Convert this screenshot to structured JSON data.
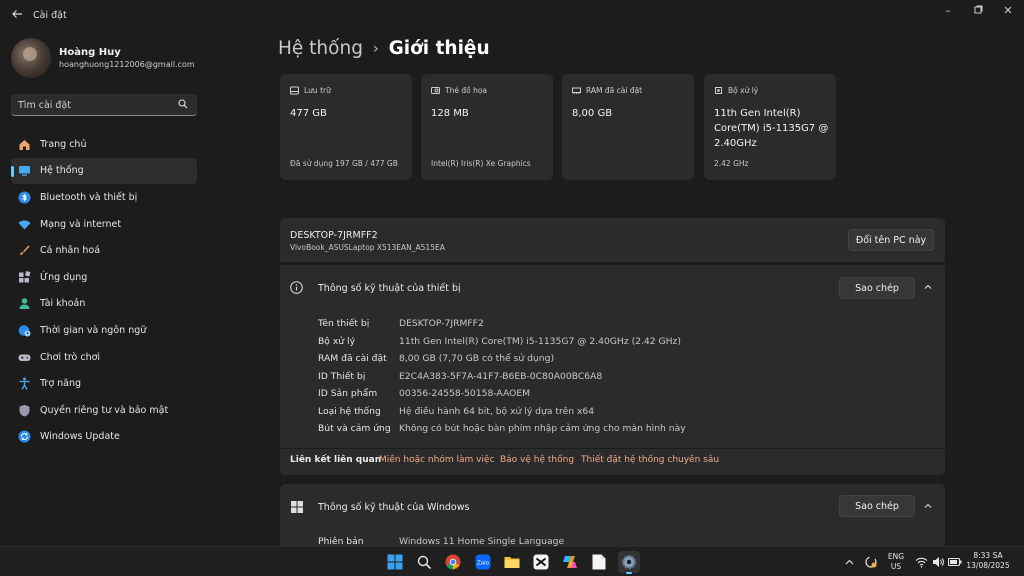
{
  "window": {
    "title": "Cài đặt"
  },
  "user": {
    "name": "Hoàng Huy",
    "email": "hoanghuong1212006@gmail.com"
  },
  "search": {
    "placeholder": "Tìm cài đặt"
  },
  "sidebar": {
    "items": [
      {
        "label": "Trang chủ",
        "icon": "home-icon"
      },
      {
        "label": "Hệ thống",
        "icon": "system-icon",
        "active": true
      },
      {
        "label": "Bluetooth và thiết bị",
        "icon": "bluetooth-icon"
      },
      {
        "label": "Mạng và internet",
        "icon": "wifi-icon"
      },
      {
        "label": "Cá nhân hoá",
        "icon": "brush-icon"
      },
      {
        "label": "Ứng dụng",
        "icon": "apps-icon"
      },
      {
        "label": "Tài khoản",
        "icon": "account-icon"
      },
      {
        "label": "Thời gian và ngôn ngữ",
        "icon": "globe-clock-icon"
      },
      {
        "label": "Chơi trò chơi",
        "icon": "gamepad-icon"
      },
      {
        "label": "Trợ năng",
        "icon": "accessibility-icon"
      },
      {
        "label": "Quyền riêng tư và bảo mật",
        "icon": "shield-icon"
      },
      {
        "label": "Windows Update",
        "icon": "update-icon"
      }
    ]
  },
  "breadcrumb": {
    "parent": "Hệ thống",
    "separator": "›",
    "current": "Giới thiệu"
  },
  "cards": [
    {
      "label": "Lưu trữ",
      "value": "477 GB",
      "sub": "Đã sử dụng 197 GB / 477 GB",
      "icon": "storage-icon"
    },
    {
      "label": "Thẻ đồ họa",
      "value": "128 MB",
      "sub": "Intel(R) Iris(R) Xe Graphics",
      "icon": "gpu-icon"
    },
    {
      "label": "RAM đã cài đặt",
      "value": "8,00 GB",
      "sub": "",
      "icon": "ram-icon"
    },
    {
      "label": "Bộ xử lý",
      "value": "11th Gen Intel(R) Core(TM) i5-1135G7 @ 2.40GHz",
      "sub": "2.42 GHz",
      "icon": "cpu-icon"
    }
  ],
  "device": {
    "name": "DESKTOP-7JRMFF2",
    "model": "VivoBook_ASUSLaptop X513EAN_A515EA",
    "rename_label": "Đổi tên PC này"
  },
  "device_specs": {
    "title": "Thông số kỹ thuật của thiết bị",
    "copy_label": "Sao chép",
    "rows": [
      {
        "key": "Tên thiết bị",
        "value": "DESKTOP-7JRMFF2"
      },
      {
        "key": "Bộ xử lý",
        "value": "11th Gen Intel(R) Core(TM) i5-1135G7 @ 2.40GHz (2.42 GHz)"
      },
      {
        "key": "RAM đã cài đặt",
        "value": "8,00 GB (7,70 GB có thể sử dụng)"
      },
      {
        "key": "ID Thiết bị",
        "value": "E2C4A383-5F7A-41F7-B6EB-0C80A00BC6A8"
      },
      {
        "key": "ID Sản phẩm",
        "value": "00356-24558-50158-AAOEM"
      },
      {
        "key": "Loại hệ thống",
        "value": "Hệ điều hành 64 bit, bộ xử lý dựa trên x64"
      },
      {
        "key": "Bút và cảm ứng",
        "value": "Không có bút hoặc bàn phím nhập cảm ứng cho màn hình này"
      }
    ]
  },
  "related": {
    "title": "Liên kết liên quan",
    "links": [
      "Miền hoặc nhóm làm việc",
      "Bảo vệ hệ thống",
      "Thiết đặt hệ thống chuyên sâu"
    ]
  },
  "windows_specs": {
    "title": "Thông số kỹ thuật của Windows",
    "copy_label": "Sao chép",
    "rows": [
      {
        "key": "Phiên bản",
        "value": "Windows 11 Home Single Language"
      }
    ]
  },
  "taskbar": {
    "apps": [
      "windows-start-icon",
      "search-icon",
      "chrome-icon",
      "zalo-icon",
      "file-explorer-icon",
      "capcut-icon",
      "copilot-icon",
      "notepad-icon",
      "settings-icon"
    ],
    "zalo_text": "Zalo",
    "lang_line1": "ENG",
    "lang_line2": "US",
    "time": "8:33 SA",
    "date": "13/08/2025"
  },
  "colors": {
    "accent": "#60cdff",
    "link": "#f0a988",
    "background": "#1c1c1c",
    "card": "#2b2b2b"
  }
}
